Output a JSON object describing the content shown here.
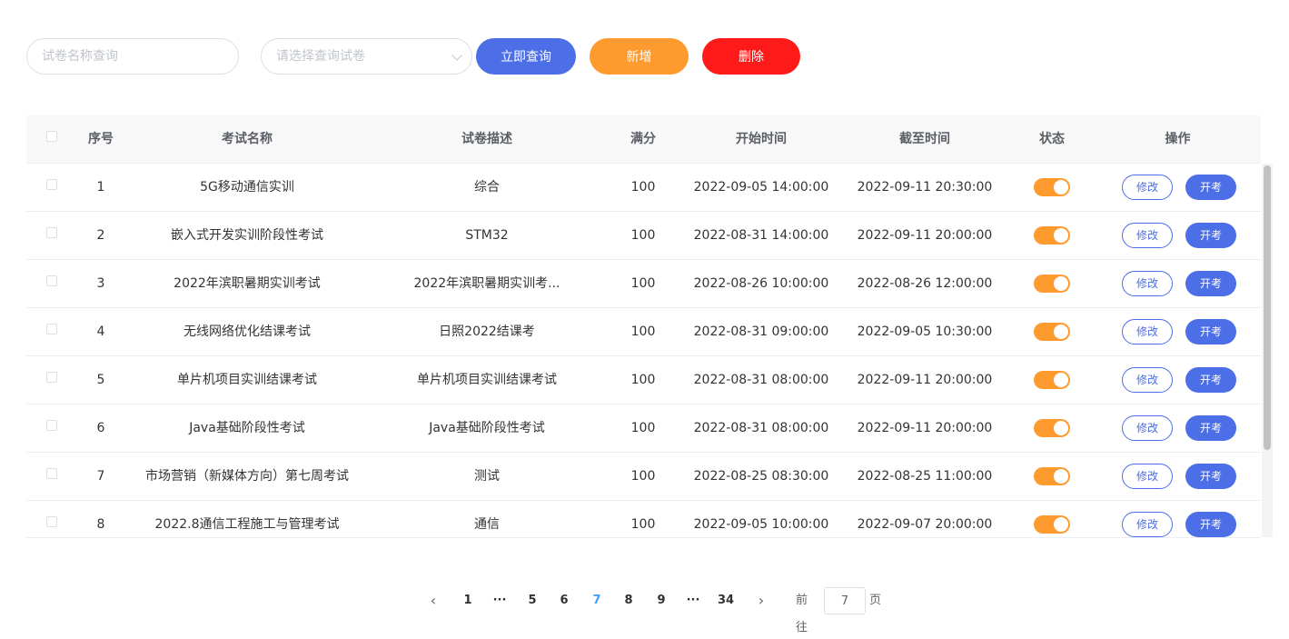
{
  "toolbar": {
    "name_placeholder": "试卷名称查询",
    "select_placeholder": "请选择查询试卷",
    "search_label": "立即查询",
    "add_label": "新增",
    "delete_label": "删除"
  },
  "table": {
    "headers": {
      "index": "序号",
      "name": "考试名称",
      "desc": "试卷描述",
      "score": "满分",
      "start": "开始时间",
      "end": "截至时间",
      "status": "状态",
      "ops": "操作"
    },
    "edit_label": "修改",
    "start_label": "开考",
    "rows": [
      {
        "index": "1",
        "name": "5G移动通信实训",
        "desc": "综合",
        "score": "100",
        "start": "2022-09-05 14:00:00",
        "end": "2022-09-11 20:30:00",
        "status_on": true
      },
      {
        "index": "2",
        "name": "嵌入式开发实训阶段性考试",
        "desc": "STM32",
        "score": "100",
        "start": "2022-08-31 14:00:00",
        "end": "2022-09-11 20:00:00",
        "status_on": true
      },
      {
        "index": "3",
        "name": "2022年滨职暑期实训考试",
        "desc": "2022年滨职暑期实训考...",
        "score": "100",
        "start": "2022-08-26 10:00:00",
        "end": "2022-08-26 12:00:00",
        "status_on": true
      },
      {
        "index": "4",
        "name": "无线网络优化结课考试",
        "desc": "日照2022结课考",
        "score": "100",
        "start": "2022-08-31 09:00:00",
        "end": "2022-09-05 10:30:00",
        "status_on": true
      },
      {
        "index": "5",
        "name": "单片机项目实训结课考试",
        "desc": "单片机项目实训结课考试",
        "score": "100",
        "start": "2022-08-31 08:00:00",
        "end": "2022-09-11 20:00:00",
        "status_on": true
      },
      {
        "index": "6",
        "name": "Java基础阶段性考试",
        "desc": "Java基础阶段性考试",
        "score": "100",
        "start": "2022-08-31 08:00:00",
        "end": "2022-09-11 20:00:00",
        "status_on": true
      },
      {
        "index": "7",
        "name": "市场营销（新媒体方向）第七周考试",
        "desc": "测试",
        "score": "100",
        "start": "2022-08-25 08:30:00",
        "end": "2022-08-25 11:00:00",
        "status_on": true
      },
      {
        "index": "8",
        "name": "2022.8通信工程施工与管理考试",
        "desc": "通信",
        "score": "100",
        "start": "2022-09-05 10:00:00",
        "end": "2022-09-07 20:00:00",
        "status_on": true
      }
    ]
  },
  "pagination": {
    "items": [
      "1",
      "···",
      "5",
      "6",
      "7",
      "8",
      "9",
      "···",
      "34"
    ],
    "current": "7",
    "goto_prefix": "前往",
    "goto_value": "7",
    "goto_suffix": "页"
  },
  "colors": {
    "primary": "#4c6ee6",
    "add": "#ff9a2e",
    "delete": "#ff1a1a",
    "toggle_on": "#ff9a2e",
    "active_page": "#409eff"
  }
}
